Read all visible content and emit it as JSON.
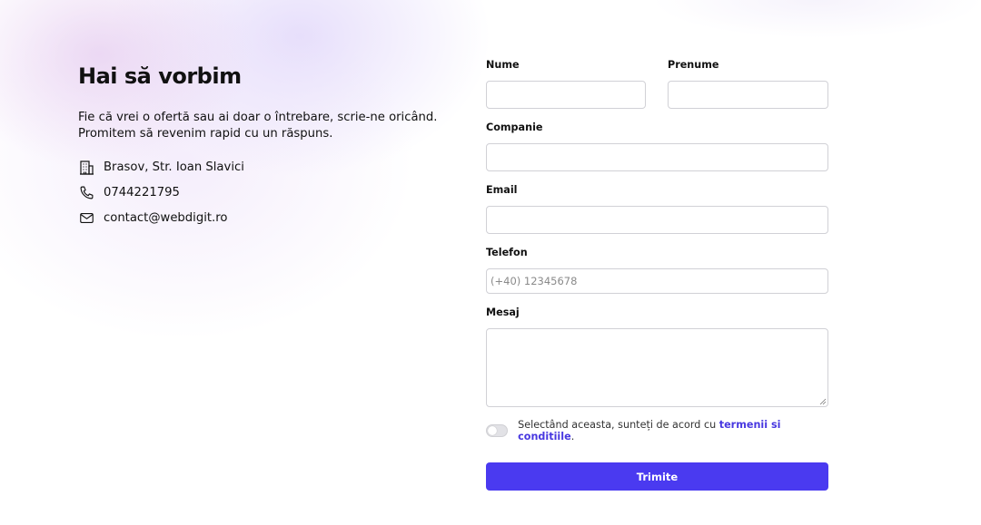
{
  "contact": {
    "title": "Hai să vorbim",
    "intro": "Fie că vrei o ofertă sau ai doar o întrebare, scrie-ne oricând. Promitem să revenim rapid cu un răspuns.",
    "items": [
      {
        "icon": "building-icon",
        "text": "Brasov, Str. Ioan Slavici"
      },
      {
        "icon": "phone-icon",
        "text": "0744221795"
      },
      {
        "icon": "mail-icon",
        "text": "contact@webdigit.ro"
      }
    ]
  },
  "form": {
    "nume_label": "Nume",
    "prenume_label": "Prenume",
    "companie_label": "Companie",
    "email_label": "Email",
    "telefon_label": "Telefon",
    "telefon_placeholder": "(+40) 12345678",
    "mesaj_label": "Mesaj",
    "consent_text": "Selectând aceasta, sunteți de acord cu ",
    "consent_link": "termenii si conditiile",
    "consent_end": ".",
    "consent_checked": false,
    "submit_label": "Trimite",
    "accent_color": "#4a3af0"
  }
}
